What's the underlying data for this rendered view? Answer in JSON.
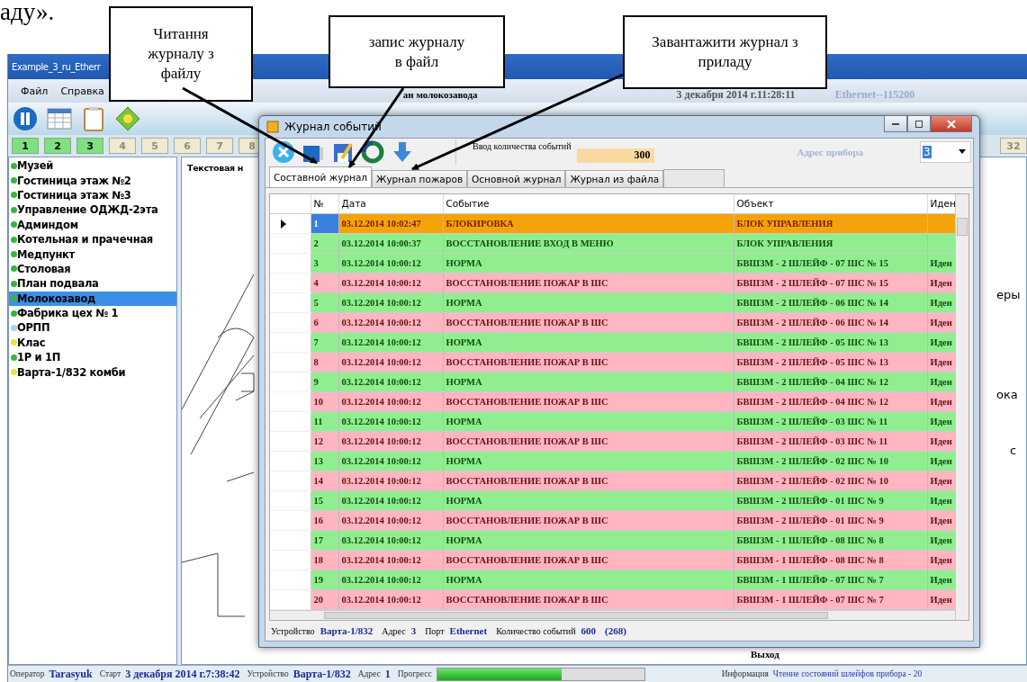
{
  "document_text": "аду».",
  "callouts": [
    {
      "text": "Читання журналу з файлу"
    },
    {
      "text": "запис журналу в файл"
    },
    {
      "text": "Завантажити журнал з приладу"
    }
  ],
  "window": {
    "title": "Example_3_ru_Etherr",
    "menu": [
      "Файл",
      "Справка"
    ],
    "header": {
      "plan": "ан молокозавода",
      "datetime": "3 декабря 2014 г.11:28:11",
      "connection": "Ethernet--115200"
    }
  },
  "page_buttons": [
    {
      "label": "1",
      "enabled": true
    },
    {
      "label": "2",
      "enabled": true
    },
    {
      "label": "3",
      "enabled": true
    },
    {
      "label": "4",
      "enabled": false
    },
    {
      "label": "5",
      "enabled": false
    },
    {
      "label": "6",
      "enabled": false
    },
    {
      "label": "7",
      "enabled": false
    },
    {
      "label": "8",
      "enabled": false
    }
  ],
  "page_button_last": {
    "label": "32",
    "enabled": false
  },
  "sidebar": {
    "items": [
      {
        "label": "Музей",
        "color": "#3cb43c",
        "selected": false
      },
      {
        "label": "Гостиница этаж №2",
        "color": "#3cb43c",
        "selected": false
      },
      {
        "label": "Гостиница этаж №3",
        "color": "#3cb43c",
        "selected": false
      },
      {
        "label": "Управление ОДЖД-2эта",
        "color": "#3cb43c",
        "selected": false
      },
      {
        "label": "Админдом",
        "color": "#3cb43c",
        "selected": false
      },
      {
        "label": "Котельная и прачечная",
        "color": "#3cb43c",
        "selected": false
      },
      {
        "label": "Медпункт",
        "color": "#3cb43c",
        "selected": false
      },
      {
        "label": "Столовая",
        "color": "#3cb43c",
        "selected": false
      },
      {
        "label": "План подвала",
        "color": "#3cb43c",
        "selected": false
      },
      {
        "label": "Молокозавод",
        "color": "#3cb43c",
        "selected": true
      },
      {
        "label": "Фабрика цех № 1",
        "color": "#3cb43c",
        "selected": false
      },
      {
        "label": "ОРПП",
        "color": "#a8d0e8",
        "selected": false
      },
      {
        "label": "Клас",
        "color": "#f0e040",
        "selected": false
      },
      {
        "label": "1Р и 1П",
        "color": "#3cb43c",
        "selected": false
      },
      {
        "label": "Варта-1/832 комби",
        "color": "#f0e040",
        "selected": false
      }
    ]
  },
  "map": {
    "label": "Текстовая н",
    "side_texts": [
      "еры",
      "ока",
      "с"
    ],
    "exit_label": "Выход"
  },
  "dialog": {
    "title": "Журнал событий",
    "count_label": "Ввод количества событий",
    "count_value": "300",
    "address_label": "Адрес прибора",
    "address_value": "3",
    "tabs": [
      {
        "label": "Составной журнал",
        "selected": true
      },
      {
        "label": "Журнал пожаров",
        "selected": false
      },
      {
        "label": "Основной журнал",
        "selected": false
      },
      {
        "label": "Журнал из файла",
        "selected": false
      }
    ],
    "table": {
      "columns": [
        "№",
        "Дата",
        "Событие",
        "Объект",
        "Иден"
      ],
      "rows": [
        {
          "kind": "alarm",
          "selected": true,
          "cells": [
            "1",
            "03.12.2014 10:02:47",
            "БЛОКИРОВКА",
            "БЛОК УПРАВЛЕНИЯ",
            ""
          ]
        },
        {
          "kind": "normal",
          "selected": false,
          "cells": [
            "2",
            "03.12.2014 10:00:37",
            "ВОССТАНОВЛЕНИЕ ВХОД В МЕНЮ",
            "БЛОК УПРАВЛЕНИЯ",
            ""
          ]
        },
        {
          "kind": "normal",
          "selected": false,
          "cells": [
            "3",
            "03.12.2014 10:00:12",
            "НОРМА",
            "БВШЗМ - 2  ШЛЕЙФ - 07  ШС № 15",
            "Иден"
          ]
        },
        {
          "kind": "fire",
          "selected": false,
          "cells": [
            "4",
            "03.12.2014 10:00:12",
            "ВОССТАНОВЛЕНИЕ ПОЖАР В ШС",
            "БВШЗМ - 2  ШЛЕЙФ - 07  ШС № 15",
            "Иден"
          ]
        },
        {
          "kind": "normal",
          "selected": false,
          "cells": [
            "5",
            "03.12.2014 10:00:12",
            "НОРМА",
            "БВШЗМ - 2  ШЛЕЙФ - 06  ШС № 14",
            "Иден"
          ]
        },
        {
          "kind": "fire",
          "selected": false,
          "cells": [
            "6",
            "03.12.2014 10:00:12",
            "ВОССТАНОВЛЕНИЕ ПОЖАР В ШС",
            "БВШЗМ - 2  ШЛЕЙФ - 06  ШС № 14",
            "Иден"
          ]
        },
        {
          "kind": "normal",
          "selected": false,
          "cells": [
            "7",
            "03.12.2014 10:00:12",
            "НОРМА",
            "БВШЗМ - 2  ШЛЕЙФ - 05  ШС № 13",
            "Иден"
          ]
        },
        {
          "kind": "fire",
          "selected": false,
          "cells": [
            "8",
            "03.12.2014 10:00:12",
            "ВОССТАНОВЛЕНИЕ ПОЖАР В ШС",
            "БВШЗМ - 2  ШЛЕЙФ - 05  ШС № 13",
            "Иден"
          ]
        },
        {
          "kind": "normal",
          "selected": false,
          "cells": [
            "9",
            "03.12.2014 10:00:12",
            "НОРМА",
            "БВШЗМ - 2  ШЛЕЙФ - 04  ШС № 12",
            "Иден"
          ]
        },
        {
          "kind": "fire",
          "selected": false,
          "cells": [
            "10",
            "03.12.2014 10:00:12",
            "ВОССТАНОВЛЕНИЕ ПОЖАР В ШС",
            "БВШЗМ - 2  ШЛЕЙФ - 04  ШС № 12",
            "Иден"
          ]
        },
        {
          "kind": "normal",
          "selected": false,
          "cells": [
            "11",
            "03.12.2014 10:00:12",
            "НОРМА",
            "БВШЗМ - 2  ШЛЕЙФ - 03  ШС № 11",
            "Иден"
          ]
        },
        {
          "kind": "fire",
          "selected": false,
          "cells": [
            "12",
            "03.12.2014 10:00:12",
            "ВОССТАНОВЛЕНИЕ ПОЖАР В ШС",
            "БВШЗМ - 2  ШЛЕЙФ - 03  ШС № 11",
            "Иден"
          ]
        },
        {
          "kind": "normal",
          "selected": false,
          "cells": [
            "13",
            "03.12.2014 10:00:12",
            "НОРМА",
            "БВШЗМ - 2  ШЛЕЙФ - 02  ШС № 10",
            "Иден"
          ]
        },
        {
          "kind": "fire",
          "selected": false,
          "cells": [
            "14",
            "03.12.2014 10:00:12",
            "ВОССТАНОВЛЕНИЕ ПОЖАР В ШС",
            "БВШЗМ - 2  ШЛЕЙФ - 02  ШС № 10",
            "Иден"
          ]
        },
        {
          "kind": "normal",
          "selected": false,
          "cells": [
            "15",
            "03.12.2014 10:00:12",
            "НОРМА",
            "БВШЗМ - 2  ШЛЕЙФ - 01  ШС № 9",
            "Иден"
          ]
        },
        {
          "kind": "fire",
          "selected": false,
          "cells": [
            "16",
            "03.12.2014 10:00:12",
            "ВОССТАНОВЛЕНИЕ ПОЖАР В ШС",
            "БВШЗМ - 2  ШЛЕЙФ - 01  ШС № 9",
            "Иден"
          ]
        },
        {
          "kind": "normal",
          "selected": false,
          "cells": [
            "17",
            "03.12.2014 10:00:12",
            "НОРМА",
            "БВШЗМ - 1  ШЛЕЙФ - 08  ШС № 8",
            "Иден"
          ]
        },
        {
          "kind": "fire",
          "selected": false,
          "cells": [
            "18",
            "03.12.2014 10:00:12",
            "ВОССТАНОВЛЕНИЕ ПОЖАР В ШС",
            "БВШЗМ - 1  ШЛЕЙФ - 08  ШС № 8",
            "Иден"
          ]
        },
        {
          "kind": "normal",
          "selected": false,
          "cells": [
            "19",
            "03.12.2014 10:00:12",
            "НОРМА",
            "БВШЗМ - 1  ШЛЕЙФ - 07  ШС № 7",
            "Иден"
          ]
        },
        {
          "kind": "fire",
          "selected": false,
          "cells": [
            "20",
            "03.12.2014 10:00:12",
            "ВОССТАНОВЛЕНИЕ ПОЖАР В ШС",
            "БВШЗМ - 1  ШЛЕЙФ - 07  ШС № 7",
            "Иден"
          ]
        }
      ]
    },
    "footer": [
      {
        "label": "Устройство",
        "value": "Варта-1/832"
      },
      {
        "label": "Адрес",
        "value": "3"
      },
      {
        "label": "Порт",
        "value": "Ethernet"
      },
      {
        "label": "Количество событий",
        "value": "600"
      },
      {
        "value": "(268)"
      }
    ]
  },
  "status_bar": {
    "fields": [
      {
        "label": "Оператор",
        "value": "Tarasyuk"
      },
      {
        "label": "Старт",
        "value": "3 декабря 2014 г.7:38:42"
      },
      {
        "label": "Устройство",
        "value": "Варта-1/832"
      },
      {
        "label": "Адрес",
        "value": "1"
      }
    ],
    "progress_label": "Прогресс",
    "progress": {
      "level": 0.6
    },
    "info_label": "Информация",
    "info_value": "Чтение состояний шлейфов прибора - 20"
  }
}
